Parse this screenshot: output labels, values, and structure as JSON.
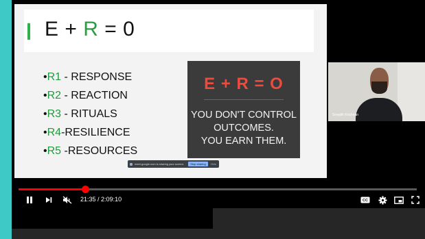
{
  "slide": {
    "title_parts": {
      "e": "E",
      "plus": "+",
      "r": "R",
      "eq": "= 0"
    },
    "items": [
      {
        "code": "R1",
        "text": " - RESPONSE"
      },
      {
        "code": "R2",
        "text": " - REACTION"
      },
      {
        "code": "R3",
        "text": " - RITUALS"
      },
      {
        "code": "R4",
        "text": "-RESILIENCE"
      },
      {
        "code": "R5",
        "text": " -RESOURCES"
      }
    ],
    "callout": {
      "equation": "E + R = O",
      "line1": "YOU DON'T CONTROL",
      "line2": "OUTCOMES.",
      "line3": "YOU EARN THEM."
    },
    "share_bar": {
      "message": "meet.google.com is sharing your screen.",
      "stop_label": "Stop sharing",
      "hide_label": "Hide"
    }
  },
  "webcam": {
    "name": "Sreejith Krishnan"
  },
  "player": {
    "current_time": "21:35",
    "separator": " / ",
    "duration": "2:09:10",
    "progress_fraction": 0.1672,
    "accent": "#ff0000",
    "icons": [
      "pause-icon",
      "next-icon",
      "mute-icon",
      "captions-icon",
      "settings-icon",
      "miniplayer-icon",
      "fullscreen-icon"
    ]
  }
}
